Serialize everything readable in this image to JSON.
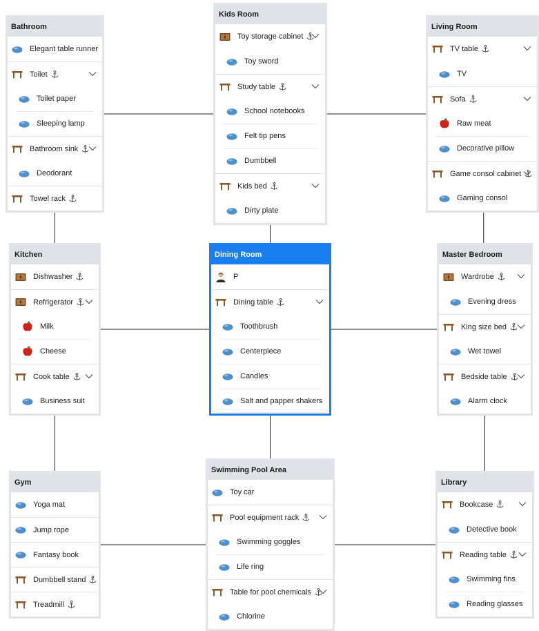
{
  "rooms": [
    {
      "name": "Bathroom",
      "rows": [
        {
          "kind": "object",
          "label": "Elegant table runner",
          "level": 0
        },
        {
          "kind": "furniture",
          "label": "Toilet",
          "level": 0,
          "anchor": true,
          "expand": true
        },
        {
          "kind": "object",
          "label": "Toilet paper",
          "level": 1
        },
        {
          "kind": "object",
          "label": "Sleeping lamp",
          "level": 1
        },
        {
          "kind": "furniture",
          "label": "Bathroom sink",
          "level": 0,
          "anchor": true,
          "expand": true
        },
        {
          "kind": "object",
          "label": "Deodorant",
          "level": 1
        },
        {
          "kind": "furniture",
          "label": "Towel rack",
          "level": 0,
          "anchor": true
        }
      ]
    },
    {
      "name": "Kids Room",
      "rows": [
        {
          "kind": "cabinet",
          "label": "Toy storage cabinet",
          "level": 0,
          "anchor": true,
          "expand": true
        },
        {
          "kind": "object",
          "label": "Toy sword",
          "level": 1
        },
        {
          "kind": "furniture",
          "label": "Study table",
          "level": 0,
          "anchor": true,
          "expand": true
        },
        {
          "kind": "object",
          "label": "School notebooks",
          "level": 1
        },
        {
          "kind": "object",
          "label": "Felt tip pens",
          "level": 1
        },
        {
          "kind": "object",
          "label": "Dumbbell",
          "level": 1
        },
        {
          "kind": "furniture",
          "label": "Kids bed",
          "level": 0,
          "anchor": true,
          "expand": true
        },
        {
          "kind": "object",
          "label": "Dirty plate",
          "level": 1
        }
      ]
    },
    {
      "name": "Living Room",
      "rows": [
        {
          "kind": "furniture",
          "label": "TV table",
          "level": 0,
          "anchor": true,
          "expand": true
        },
        {
          "kind": "object",
          "label": "TV",
          "level": 1
        },
        {
          "kind": "furniture",
          "label": "Sofa",
          "level": 0,
          "anchor": true,
          "expand": true
        },
        {
          "kind": "food",
          "label": "Raw meat",
          "level": 1
        },
        {
          "kind": "object",
          "label": "Decorative pillow",
          "level": 1
        },
        {
          "kind": "furniture",
          "label": "Game consol cabinet",
          "level": 0,
          "anchor": true,
          "expand": true
        },
        {
          "kind": "object",
          "label": "Gaming consol",
          "level": 1
        }
      ]
    },
    {
      "name": "Kitchen",
      "rows": [
        {
          "kind": "cabinet",
          "label": "Dishwasher",
          "level": 0,
          "anchor": true
        },
        {
          "kind": "cabinet",
          "label": "Refrigerator",
          "level": 0,
          "anchor": true,
          "expand": true
        },
        {
          "kind": "food",
          "label": "Milk",
          "level": 1
        },
        {
          "kind": "food",
          "label": "Cheese",
          "level": 1
        },
        {
          "kind": "furniture",
          "label": "Cook table",
          "level": 0,
          "anchor": true,
          "expand": true
        },
        {
          "kind": "object",
          "label": "Business suit",
          "level": 1
        }
      ]
    },
    {
      "name": "Dining Room",
      "active": true,
      "rows": [
        {
          "kind": "person",
          "label": "P",
          "level": 0
        },
        {
          "kind": "furniture",
          "label": "Dining table",
          "level": 0,
          "anchor": true,
          "expand": true
        },
        {
          "kind": "object",
          "label": "Toothbrush",
          "level": 1
        },
        {
          "kind": "object",
          "label": "Centerpiece",
          "level": 1
        },
        {
          "kind": "object",
          "label": "Candles",
          "level": 1
        },
        {
          "kind": "object",
          "label": "Salt and papper shakers",
          "level": 1
        }
      ]
    },
    {
      "name": "Master Bedroom",
      "rows": [
        {
          "kind": "cabinet",
          "label": "Wardrobe",
          "level": 0,
          "anchor": true,
          "expand": true
        },
        {
          "kind": "object",
          "label": "Evening dress",
          "level": 1
        },
        {
          "kind": "furniture",
          "label": "King size bed",
          "level": 0,
          "anchor": true,
          "expand": true
        },
        {
          "kind": "object",
          "label": "Wet towel",
          "level": 1
        },
        {
          "kind": "furniture",
          "label": "Bedside table",
          "level": 0,
          "anchor": true,
          "expand": true
        },
        {
          "kind": "object",
          "label": "Alarm clock",
          "level": 1
        }
      ]
    },
    {
      "name": "Gym",
      "rows": [
        {
          "kind": "object",
          "label": "Yoga mat",
          "level": 0
        },
        {
          "kind": "object",
          "label": "Jump rope",
          "level": 0
        },
        {
          "kind": "object",
          "label": "Fantasy book",
          "level": 0
        },
        {
          "kind": "furniture",
          "label": "Dumbbell stand",
          "level": 0,
          "anchor": true
        },
        {
          "kind": "furniture",
          "label": "Treadmill",
          "level": 0,
          "anchor": true
        }
      ]
    },
    {
      "name": "Swimming Pool Area",
      "rows": [
        {
          "kind": "object",
          "label": "Toy car",
          "level": 0
        },
        {
          "kind": "furniture",
          "label": "Pool equipment rack",
          "level": 0,
          "anchor": true,
          "expand": true
        },
        {
          "kind": "object",
          "label": "Swimming goggles",
          "level": 1
        },
        {
          "kind": "object",
          "label": "Life ring",
          "level": 1
        },
        {
          "kind": "furniture",
          "label": "Table for pool chemicals",
          "level": 0,
          "anchor": true,
          "expand": true
        },
        {
          "kind": "object",
          "label": "Chlorine",
          "level": 1
        }
      ]
    },
    {
      "name": "Library",
      "rows": [
        {
          "kind": "furniture",
          "label": "Bookcase",
          "level": 0,
          "anchor": true,
          "expand": true
        },
        {
          "kind": "object",
          "label": "Detective book",
          "level": 1
        },
        {
          "kind": "furniture",
          "label": "Reading table",
          "level": 0,
          "anchor": true,
          "expand": true
        },
        {
          "kind": "object",
          "label": "Swimming fins",
          "level": 1
        },
        {
          "kind": "object",
          "label": "Reading glasses",
          "level": 1
        }
      ]
    }
  ],
  "connections": [
    [
      "Bathroom",
      "Kids Room"
    ],
    [
      "Kids Room",
      "Living Room"
    ],
    [
      "Bathroom",
      "Kitchen"
    ],
    [
      "Kids Room",
      "Dining Room"
    ],
    [
      "Living Room",
      "Master Bedroom"
    ],
    [
      "Kitchen",
      "Dining Room"
    ],
    [
      "Dining Room",
      "Master Bedroom"
    ],
    [
      "Kitchen",
      "Gym"
    ],
    [
      "Dining Room",
      "Swimming Pool Area"
    ],
    [
      "Master Bedroom",
      "Library"
    ],
    [
      "Gym",
      "Swimming Pool Area"
    ],
    [
      "Swimming Pool Area",
      "Library"
    ]
  ],
  "colors": {
    "accent": "#1a7ef0",
    "header": "#dfe2e6",
    "border": "#e1e4e8",
    "object_icon": "#4f8fcb",
    "furniture_icon": "#8a5a2b",
    "food_icon": "#d0221a"
  },
  "icons": {
    "object": "blob-icon",
    "furniture": "table-icon",
    "cabinet": "cabinet-icon",
    "food": "apple-icon",
    "person": "person-icon",
    "anchor": "anchor-icon",
    "expand": "chevron-down-icon"
  }
}
